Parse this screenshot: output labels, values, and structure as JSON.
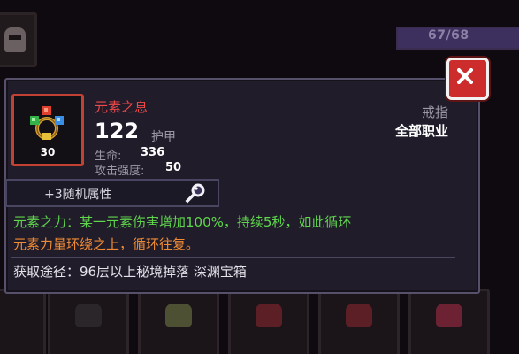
{
  "inventory": {
    "capacity_text": "67/68",
    "capacity_fraction": 0.985
  },
  "tooltip": {
    "item_name": "元素之息",
    "quantity": "30",
    "armor_value": "122",
    "armor_label": "护甲",
    "stats": [
      {
        "label": "生命:",
        "value": "336"
      },
      {
        "label": "攻击强度:",
        "value": "50"
      }
    ],
    "slot_type": "戒指",
    "class_requirement": "全部职业",
    "random_attributes": "+3随机属性",
    "effect_line1": "元素之力：某一元素伤害增加100%，持续5秒，如此循环",
    "effect_line2": "元素力量环绕之上，循环往复。",
    "source": "获取途径：96层以上秘境掉落 深渊宝箱",
    "colors": {
      "item_name": "#f0494a",
      "effect_green": "#5fd64c",
      "effect_orange": "#f08b35",
      "frame_red": "#c24133",
      "close_button": "#cc2c2c"
    },
    "icons": {
      "item": "ring-icon",
      "inspect": "magnifier-icon",
      "close": "close-icon"
    }
  }
}
